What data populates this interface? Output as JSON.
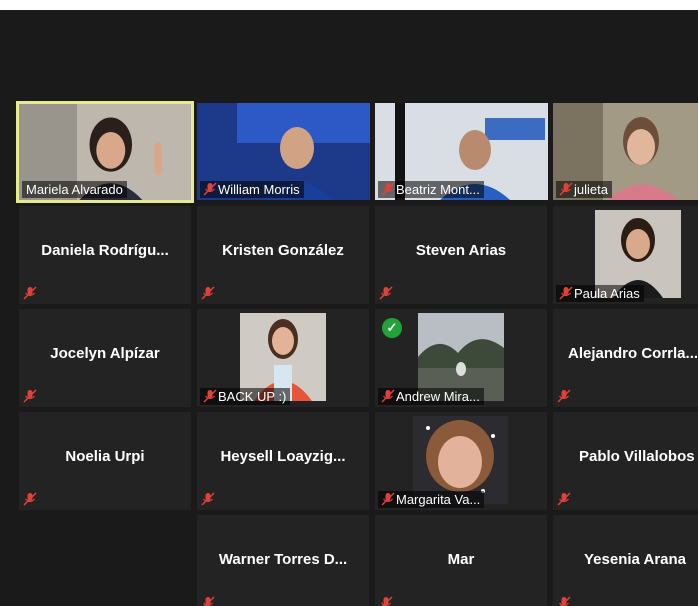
{
  "participants": [
    {
      "name": "Mariela Alvarado",
      "muted": false,
      "active": true
    },
    {
      "name": "William Morris",
      "muted": true
    },
    {
      "name": "Beatriz Mont...",
      "muted": true
    },
    {
      "name": "julieta",
      "muted": true
    },
    {
      "name": "Daniela  Rodrígu...",
      "muted": true
    },
    {
      "name": "Kristen González",
      "muted": true
    },
    {
      "name": "Steven Arias",
      "muted": true
    },
    {
      "name": "Paula Arias",
      "muted": true
    },
    {
      "name": "Jocelyn Alpízar",
      "muted": true
    },
    {
      "name": "BACK UP :)",
      "muted": true
    },
    {
      "name": "Andrew Mira...",
      "muted": true,
      "verified": true
    },
    {
      "name": "Alejandro  Corrla...",
      "muted": true
    },
    {
      "name": "Noelia Urpi",
      "muted": true
    },
    {
      "name": "Heysell  Loayzig...",
      "muted": true
    },
    {
      "name": "Margarita Va...",
      "muted": true
    },
    {
      "name": "Pablo Villalobos",
      "muted": true
    },
    {
      "name": "Warner Torres  D...",
      "muted": true
    },
    {
      "name": "Mar",
      "muted": true
    },
    {
      "name": "Yesenia Arana",
      "muted": true
    }
  ],
  "icons": {
    "muted_mic": "mic-off-icon",
    "verified": "check-circle-icon"
  },
  "colors": {
    "background": "#1a1a1a",
    "tile": "#232323",
    "active_speaker_border": "#e6ec8d",
    "muted_icon": "#e0413a",
    "check": "#21a33a"
  }
}
